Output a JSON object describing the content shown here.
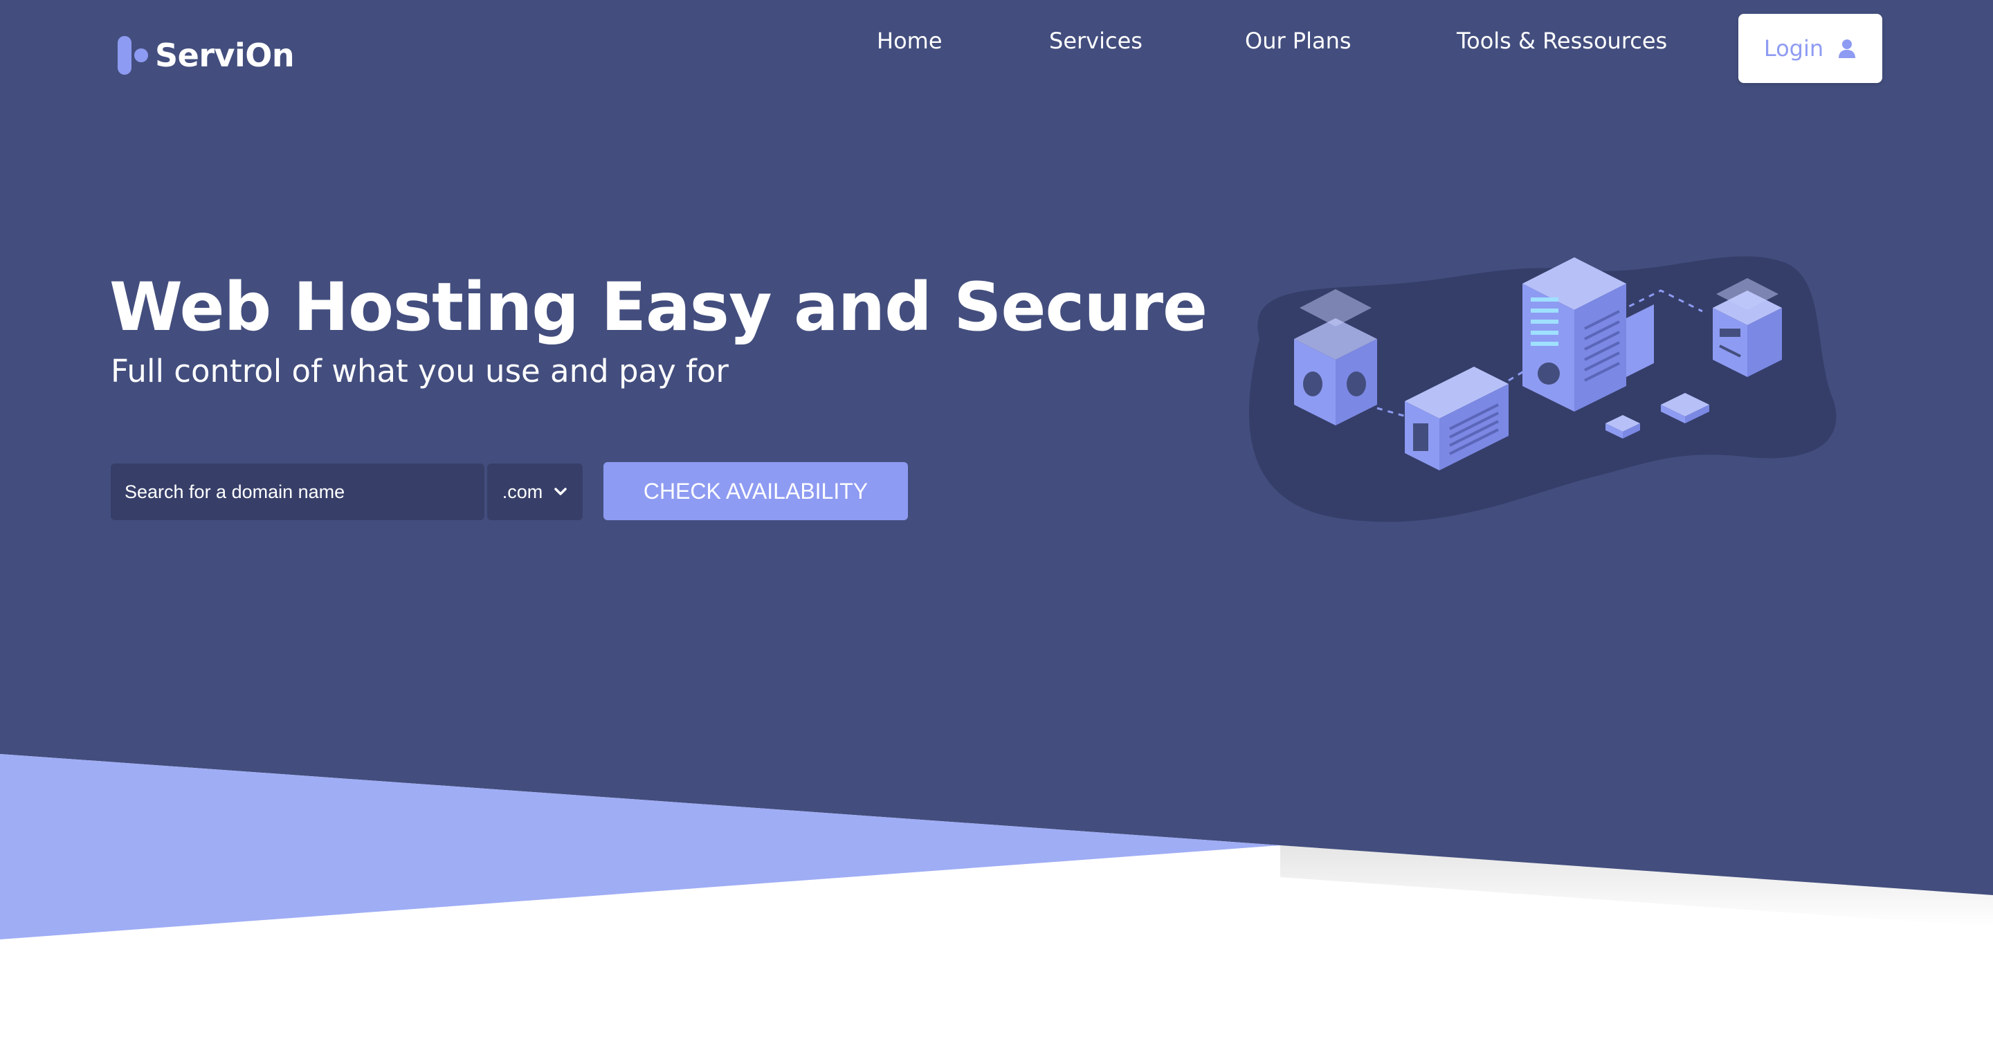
{
  "colors": {
    "hero_bg": "#434e7e",
    "accent": "#8e9bf2",
    "accent_light": "#9fadf5",
    "input_bg": "#373f69",
    "text": "#ffffff"
  },
  "brand": {
    "name": "ServiOn"
  },
  "nav": {
    "items": [
      {
        "label": "Home"
      },
      {
        "label": "Services"
      },
      {
        "label": "Our Plans"
      },
      {
        "label": "Tools & Ressources"
      }
    ],
    "login_label": "Login"
  },
  "hero": {
    "title": "Web Hosting Easy and Secure",
    "subtitle": "Full control of what you use and pay for"
  },
  "search": {
    "placeholder": "Search for a domain name",
    "value": "",
    "tld_selected": ".com",
    "button_label": "CHECK AVAILABILITY"
  },
  "icons": {
    "logo": "brand-logo-icon",
    "login": "user-icon",
    "select": "chevron-down-icon",
    "illustration": "isometric-servers-illustration"
  }
}
